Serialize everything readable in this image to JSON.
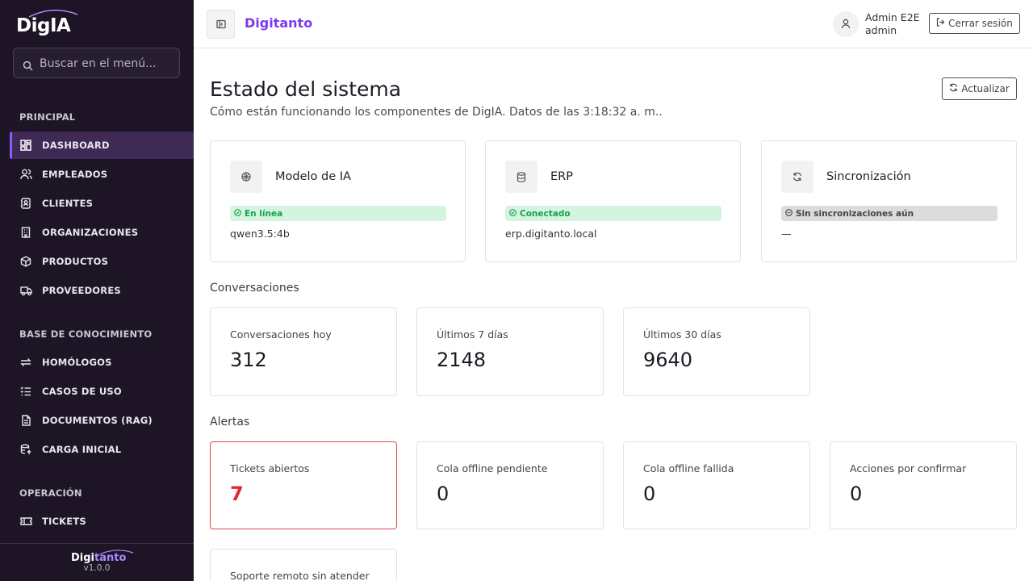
{
  "sidebar": {
    "logo": "DigIA",
    "search_placeholder": "Buscar en el menú...",
    "sections": [
      {
        "title": "PRINCIPAL",
        "items": [
          "DASHBOARD",
          "EMPLEADOS",
          "CLIENTES",
          "ORGANIZACIONES",
          "PRODUCTOS",
          "PROVEEDORES"
        ]
      },
      {
        "title": "BASE DE CONOCIMIENTO",
        "items": [
          "HOMÓLOGOS",
          "CASOS DE USO",
          "DOCUMENTOS (RAG)",
          "CARGA INICIAL"
        ]
      },
      {
        "title": "OPERACIÓN",
        "items": [
          "TICKETS"
        ]
      }
    ],
    "active_item": "DASHBOARD",
    "footer_brand_a": "Digi",
    "footer_brand_b": "tanto",
    "version": "v1.0.0"
  },
  "topbar": {
    "title": "Digitanto",
    "user_name": "Admin E2E",
    "user_role": "admin",
    "logout_label": "Cerrar sesión"
  },
  "main": {
    "title": "Estado del sistema",
    "subtitle": "Cómo están funcionando los componentes de DigIA. Datos de las 3:18:32 a. m..",
    "refresh_label": "Actualizar",
    "status_cards": [
      {
        "title": "Modelo de IA",
        "badge": "En línea",
        "badge_state": "ok",
        "detail": "qwen3.5:4b",
        "icon": "brain-icon"
      },
      {
        "title": "ERP",
        "badge": "Conectado",
        "badge_state": "ok",
        "detail": "erp.digitanto.local",
        "icon": "database-icon"
      },
      {
        "title": "Sincronización",
        "badge": "Sin sincronizaciones aún",
        "badge_state": "neutral",
        "detail": "—",
        "icon": "sync-icon"
      }
    ],
    "conversations_label": "Conversaciones",
    "conversations": [
      {
        "label": "Conversaciones hoy",
        "value": "312"
      },
      {
        "label": "Últimos 7 días",
        "value": "2148"
      },
      {
        "label": "Últimos 30 días",
        "value": "9640"
      }
    ],
    "alerts_label": "Alertas",
    "alerts": [
      {
        "label": "Tickets abiertos",
        "value": "7",
        "highlight": true
      },
      {
        "label": "Cola offline pendiente",
        "value": "0"
      },
      {
        "label": "Cola offline fallida",
        "value": "0"
      },
      {
        "label": "Acciones por confirmar",
        "value": "0"
      },
      {
        "label": "Soporte remoto sin atender",
        "value": ""
      }
    ]
  },
  "colors": {
    "sidebar_bg": "#1d1526",
    "accent": "#7c3aed",
    "success": "#16a34a",
    "alert": "#e5262f"
  }
}
